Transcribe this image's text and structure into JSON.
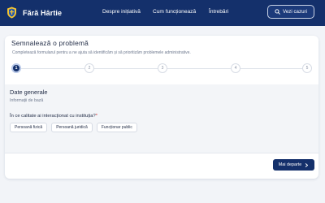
{
  "header": {
    "brand": "Fără Hârtie",
    "nav": [
      "Despre inițiativă",
      "Cum funcționează",
      "Întrebări"
    ],
    "cases_button": "Vezi cazuri"
  },
  "form": {
    "title": "Semnalează o problemă",
    "subtitle": "Completează formularul pentru a ne ajuta să identificăm și să prioritizăm problemele administrative.",
    "steps": [
      "1",
      "2",
      "3",
      "4",
      "5"
    ],
    "active_step": 1,
    "section": {
      "title": "Date generale",
      "subtitle": "Informații de bază",
      "question": "În ce calitate ai interacționat cu instituția?",
      "required_mark": "*",
      "options": [
        "Persoană fizică",
        "Persoană juridică",
        "Funcționar public"
      ]
    },
    "next_button": "Mai departe"
  },
  "colors": {
    "navbar": "#14306b",
    "accent": "#14306b",
    "required": "#d63031",
    "page_bg": "#f2f4f8"
  },
  "icons": {
    "brand": "coat-of-arms-icon",
    "cases": "search-icon",
    "next": "chevron-right-icon"
  }
}
